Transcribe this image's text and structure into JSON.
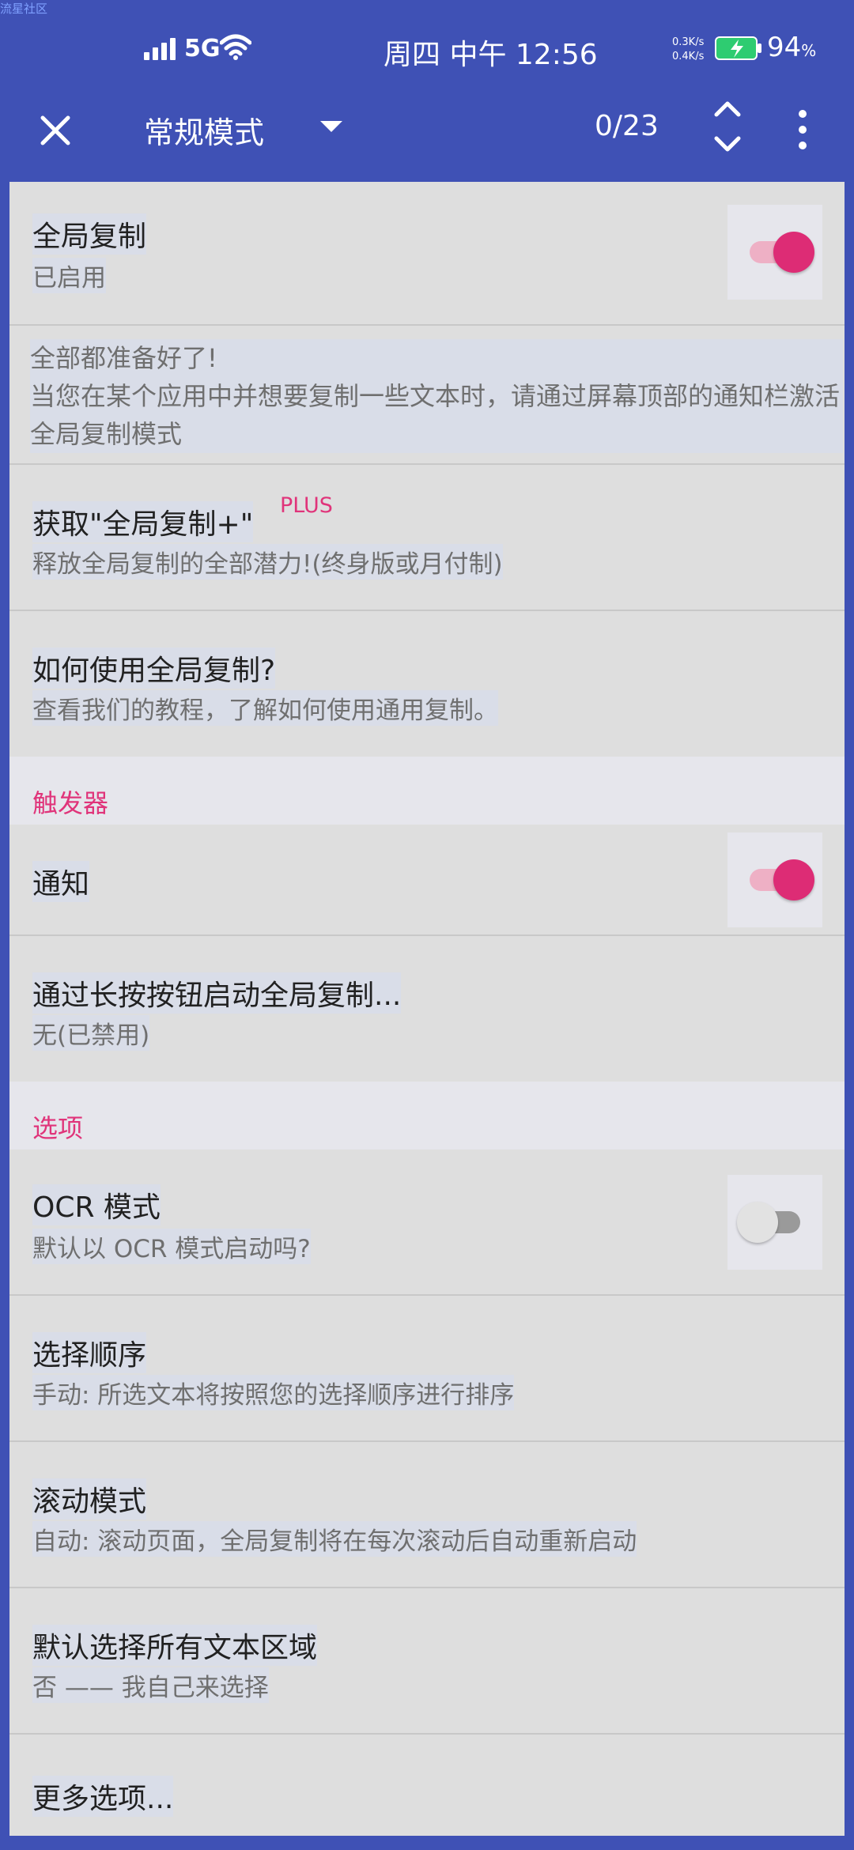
{
  "watermark": "流星社区",
  "status_bar": {
    "network": "5G",
    "time": "周四 中午 12:56",
    "speed_up": "0.3K/s",
    "speed_down": "0.4K/s",
    "battery_pct": "94",
    "battery_unit": "%"
  },
  "app_bar": {
    "mode": "常规模式",
    "counter": "0/23"
  },
  "settings": {
    "global_copy": {
      "title": "全局复制",
      "subtitle": "已启用",
      "enabled": true
    },
    "info": "全部都准备好了!\n当您在某个应用中并想要复制一些文本时，请通过屏幕顶部的通知栏激活全局复制模式",
    "get_plus": {
      "title": "获取\"全局复制+\"",
      "badge": "PLUS",
      "subtitle": "释放全局复制的全部潜力!(终身版或月付制)"
    },
    "how_to": {
      "title": "如何使用全局复制?",
      "subtitle": "查看我们的教程，了解如何使用通用复制。"
    },
    "triggers_header": "触发器",
    "notification": {
      "title": "通知",
      "enabled": true
    },
    "long_press": {
      "title": "通过长按按钮启动全局复制...",
      "subtitle": "无(已禁用)"
    },
    "options_header": "选项",
    "ocr_mode": {
      "title": "OCR 模式",
      "subtitle": "默认以 OCR 模式启动吗?",
      "enabled": false
    },
    "selection_order": {
      "title": "选择顺序",
      "subtitle": "手动: 所选文本将按照您的选择顺序进行排序"
    },
    "scroll_mode": {
      "title": "滚动模式",
      "subtitle": "自动: 滚动页面，全局复制将在每次滚动后自动重新启动"
    },
    "select_all": {
      "title": "默认选择所有文本区域",
      "subtitle": "否 —— 我自己来选择"
    },
    "more_options": {
      "title": "更多选项..."
    }
  },
  "colors": {
    "primary": "#3f51b5",
    "accent": "#dd2c75",
    "background": "#dedede"
  }
}
